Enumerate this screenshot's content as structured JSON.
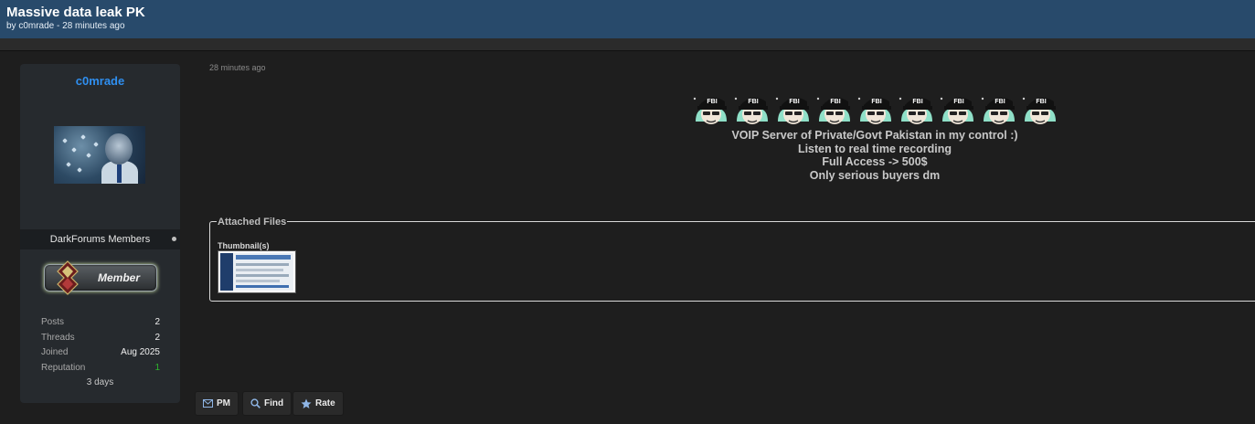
{
  "thread": {
    "title": "Massive data leak PK",
    "byline": "by c0mrade - 28 minutes ago"
  },
  "author": {
    "username": "c0mrade",
    "group": "DarkForums Members",
    "badge_text": "Member",
    "stats": [
      {
        "label": "Posts",
        "value": "2"
      },
      {
        "label": "Threads",
        "value": "2"
      },
      {
        "label": "Joined",
        "value": "Aug 2025"
      },
      {
        "label": "Reputation",
        "value": "1"
      }
    ],
    "last_visit": "3 days"
  },
  "post": {
    "time": "28 minutes ago",
    "emoji_count": 9,
    "emoji_label": "FBI",
    "lines": [
      "VOIP Server of Private/Govt Pakistan in my control :)",
      "Listen to real time recording",
      "Full Access -> 500$",
      "Only serious buyers dm"
    ]
  },
  "attachments": {
    "legend": "Attached Files",
    "thumbnails_label": "Thumbnail(s)"
  },
  "actions": {
    "pm": "PM",
    "find": "Find",
    "rate": "Rate"
  },
  "colors": {
    "header_bg": "#284a6b",
    "username": "#2f8ff0",
    "reputation": "#2db52d",
    "background": "#1e1e1e"
  }
}
